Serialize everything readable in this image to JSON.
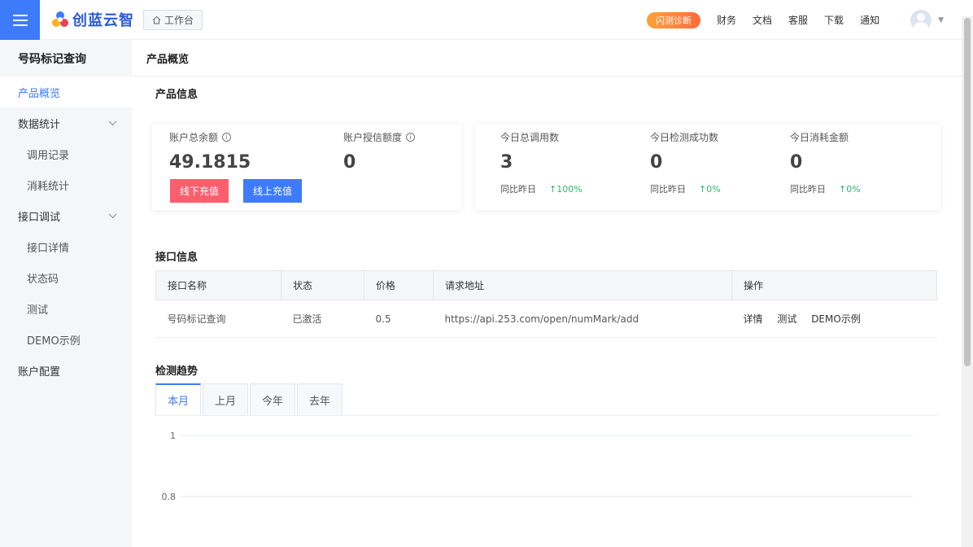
{
  "header": {
    "logo_text": "创蓝云智",
    "workbench_label": "工作台",
    "flash_label": "闪测诊断",
    "nav": [
      "财务",
      "文档",
      "客服",
      "下载",
      "通知"
    ]
  },
  "sidebar": {
    "title": "号码标记查询",
    "items": [
      {
        "label": "产品概览"
      },
      {
        "label": "数据统计"
      },
      {
        "label": "调用记录"
      },
      {
        "label": "消耗统计"
      },
      {
        "label": "接口调试"
      },
      {
        "label": "接口详情"
      },
      {
        "label": "状态码"
      },
      {
        "label": "测试"
      },
      {
        "label": "DEMO示例"
      },
      {
        "label": "账户配置"
      }
    ]
  },
  "main": {
    "page_title": "产品概览",
    "product_info_title": "产品信息",
    "balance": {
      "label": "账户总余额",
      "value": "49.1815"
    },
    "credit": {
      "label": "账户授信额度",
      "value": "0"
    },
    "offline_btn": "线下充值",
    "online_btn": "线上充值",
    "stats": [
      {
        "label": "今日总调用数",
        "value": "3",
        "compare_label": "同比昨日",
        "change": "↑100%"
      },
      {
        "label": "今日检测成功数",
        "value": "0",
        "compare_label": "同比昨日",
        "change": "↑0%"
      },
      {
        "label": "今日消耗金额",
        "value": "0",
        "compare_label": "同比昨日",
        "change": "↑0%"
      }
    ],
    "api_info_title": "接口信息",
    "table": {
      "headers": [
        "接口名称",
        "状态",
        "价格",
        "请求地址",
        "操作"
      ],
      "row": {
        "name": "号码标记查询",
        "status": "已激活",
        "price": "0.5",
        "url": "https://api.253.com/open/numMark/add",
        "ops": [
          "详情",
          "测试",
          "DEMO示例"
        ]
      }
    },
    "trend_title": "检测趋势",
    "tabs": [
      "本月",
      "上月",
      "今年",
      "去年"
    ],
    "chart_ticks": [
      "1",
      "0.8"
    ]
  },
  "chart_data": {
    "type": "line",
    "title": "",
    "xlabel": "",
    "ylabel": "",
    "y_ticks": [
      1,
      0.8
    ],
    "series": []
  }
}
